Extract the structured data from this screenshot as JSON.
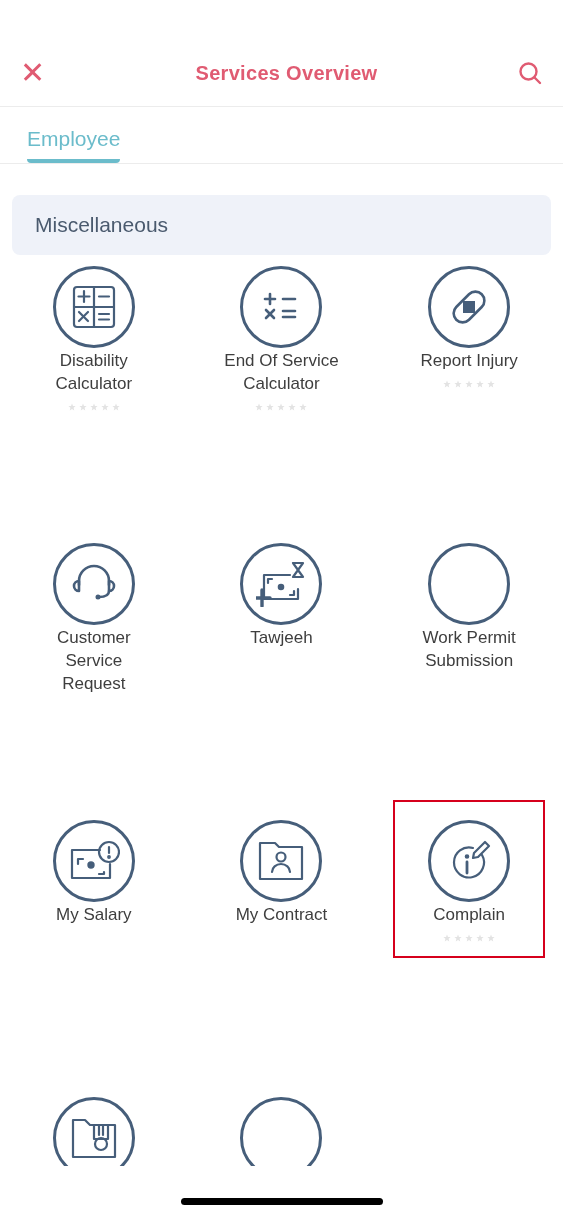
{
  "header": {
    "close": "✕",
    "title": "Services Overview"
  },
  "tabs": [
    {
      "label": "Employee",
      "selected": true
    }
  ],
  "section": {
    "title": "Miscellaneous"
  },
  "services": [
    {
      "label": "Disability Calculator",
      "stars": 0,
      "highlighted": false
    },
    {
      "label": "End Of Service Calculator",
      "stars": 0,
      "highlighted": false
    },
    {
      "label": "Report Injury",
      "stars": 0,
      "highlighted": false
    },
    {
      "label": "Customer Service Request",
      "highlighted": false
    },
    {
      "label": "Tawjeeh",
      "highlighted": false
    },
    {
      "label": "Work Permit Submission",
      "highlighted": false
    },
    {
      "label": "My Salary",
      "highlighted": false
    },
    {
      "label": "My Contract",
      "highlighted": false
    },
    {
      "label": "Complain",
      "stars": 0,
      "highlighted": true
    },
    {
      "highlighted": false
    },
    {
      "highlighted": false
    }
  ]
}
